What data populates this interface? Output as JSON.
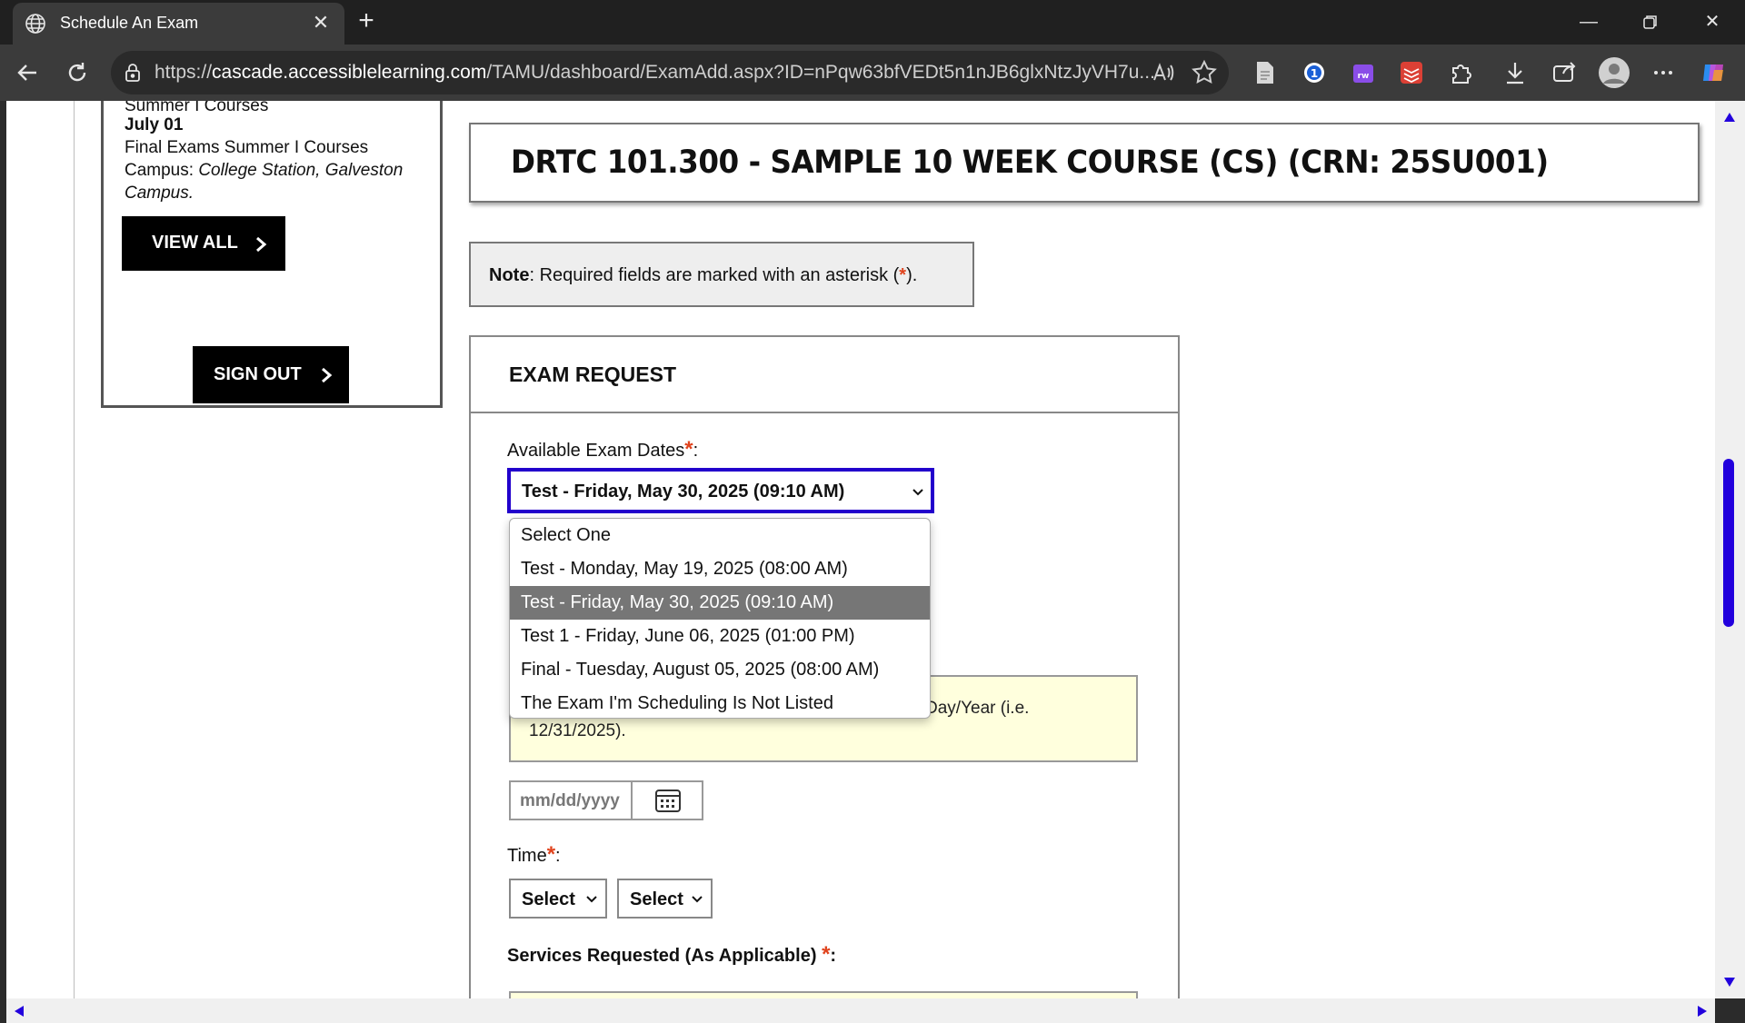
{
  "browser": {
    "tab_title": "Schedule An Exam",
    "url_prefix": "https://",
    "url_host": "cascade.accessiblelearning.com",
    "url_path": "/TAMU/dashboard/ExamAdd.aspx?ID=nPqw63bfVEDt5n1nJB6glxNtzJyVH7u..."
  },
  "sidebar": {
    "partial_line": "Summer I Courses",
    "date": "July 01",
    "event": "Final Exams Summer I Courses",
    "campus_label": "Campus:",
    "campus_value": "College Station, Galveston",
    "campus_value2": "Campus.",
    "view_all": "VIEW ALL",
    "sign_out": "SIGN OUT"
  },
  "course": {
    "title": "DRTC 101.300 - SAMPLE 10 WEEK COURSE (CS) (CRN: 25SU001)"
  },
  "note": {
    "bold": "Note",
    "text_before": ": Required fields are marked with an asterisk (",
    "asterisk": "*",
    "text_after": ")."
  },
  "exam_request": {
    "heading": "EXAM REQUEST",
    "dates_label": "Available Exam Dates",
    "asterisk": "*",
    "colon": ":",
    "selected_date": "Test - Friday, May 30, 2025 (09:10 AM)",
    "options": [
      "Select One",
      "Test - Monday, May 19, 2025 (08:00 AM)",
      "Test - Friday, May 30, 2025 (09:10 AM)",
      "Test 1 - Friday, June 06, 2025 (01:00 PM)",
      "Final - Tuesday, August 05, 2025 (08:00 AM)",
      "The Exam I'm Scheduling Is Not Listed"
    ],
    "selected_index": 2,
    "info_text_visible": "Day/Year (i.e.",
    "info_text_line2": "12/31/2025).",
    "date_placeholder": "mm/dd/yyyy",
    "time_label": "Time",
    "time_hour": "Select",
    "time_minute": "Select",
    "services_label": "Services Requested (As Applicable)"
  },
  "colors": {
    "accent": "#2200cc",
    "asterisk": "#e0431d",
    "highlight_option": "#767676",
    "info_bg": "#ffffdd"
  }
}
